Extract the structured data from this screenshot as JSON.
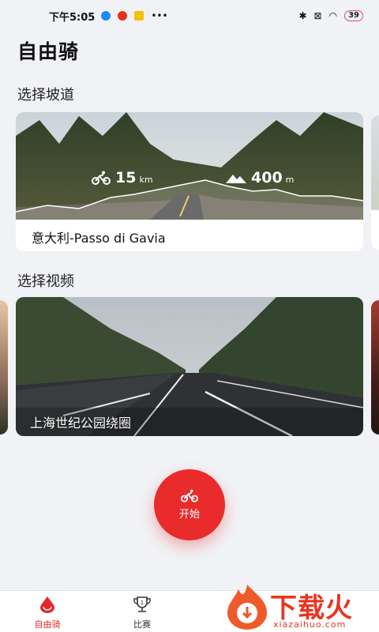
{
  "status": {
    "time": "下午5:05",
    "battery": "39",
    "app_icon_colors": [
      "#1a8cff",
      "#e8311a",
      "#f2c200"
    ]
  },
  "page": {
    "title": "自由骑"
  },
  "slope_section": {
    "title": "选择坡道",
    "card": {
      "distance_value": "15",
      "distance_unit": "km",
      "elevation_value": "400",
      "elevation_unit": "m",
      "label": "意大利-Passo di Gavia",
      "icons": [
        "bike-icon",
        "mountain-icon"
      ]
    }
  },
  "video_section": {
    "title": "选择视频",
    "card": {
      "label": "上海世纪公园绕圈"
    }
  },
  "start_button": {
    "label": "开始",
    "icon": "bike-icon",
    "color": "#ea2b2b"
  },
  "tabs": [
    {
      "label": "自由骑",
      "icon": "drop-icon",
      "active": true
    },
    {
      "label": "比赛",
      "icon": "trophy-icon",
      "active": false
    }
  ],
  "watermark": {
    "text": "下载火",
    "url": "xiazaihuo.com"
  },
  "colors": {
    "accent": "#e5262b",
    "background": "#f1f2f5"
  }
}
